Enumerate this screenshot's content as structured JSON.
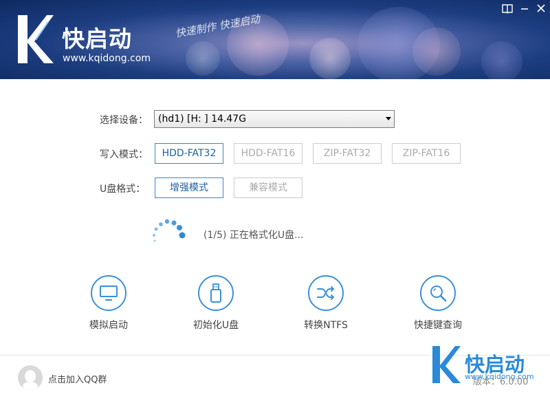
{
  "header": {
    "brand": "快启动",
    "url": "www.kqidong.com",
    "slogan": "快速制作 快速启动",
    "book_icon": "book-icon",
    "close_icon": "close-icon"
  },
  "form": {
    "device_label": "选择设备：",
    "device_value": "(hd1) [H: ]  14.47G",
    "write_mode_label": "写入模式：",
    "write_modes": [
      "HDD-FAT32",
      "HDD-FAT16",
      "ZIP-FAT32",
      "ZIP-FAT16"
    ],
    "write_mode_selected": "HDD-FAT32",
    "usb_format_label": "U盘格式：",
    "usb_formats": [
      "增强模式",
      "兼容模式"
    ],
    "usb_format_selected": "增强模式"
  },
  "progress": {
    "text": "(1/5) 正在格式化U盘..."
  },
  "tools": [
    {
      "label": "模拟启动",
      "icon": "monitor-icon"
    },
    {
      "label": "初始化U盘",
      "icon": "usb-drive-icon"
    },
    {
      "label": "转换NTFS",
      "icon": "shuffle-icon"
    },
    {
      "label": "快捷键查询",
      "icon": "search-icon"
    }
  ],
  "footer": {
    "qq_text": "点击加入QQ群",
    "brand": "快启动",
    "url": "www.kqidong.com",
    "version": "版本：6.0.00"
  },
  "colors": {
    "accent": "#3b86c9",
    "header_dark": "#0f2a62",
    "brand_blue": "#2a8ad8"
  }
}
